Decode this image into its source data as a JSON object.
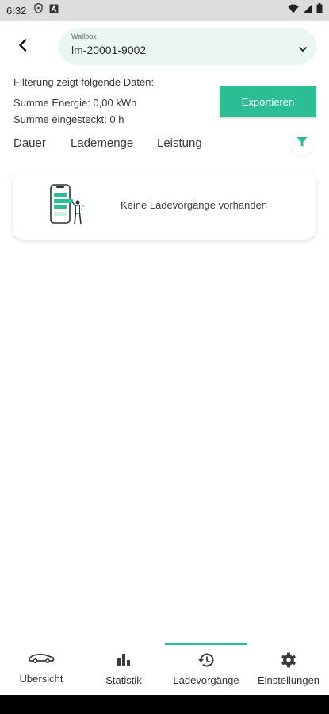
{
  "status_bar": {
    "time": "6:32",
    "left_icons": [
      "shield-icon",
      "a-badge-icon"
    ],
    "right_icons": [
      "wifi-icon",
      "signal-icon",
      "battery-icon"
    ]
  },
  "header": {
    "back_icon": "arrow-left-icon",
    "wallbox": {
      "label": "Wallbox",
      "value": "lm-20001-9002",
      "icon": "chevron-down-icon"
    }
  },
  "summary": {
    "filter_info": "Filterung zeigt folgende Daten:",
    "energy": "Summe Energie: 0,00 kWh",
    "plugged": "Summe eingesteckt: 0 h"
  },
  "export_button": "Exportieren",
  "sort_options": [
    "Dauer",
    "Lademenge",
    "Leistung"
  ],
  "filter_icon": "filter-icon",
  "empty_state": {
    "icon": "phone-person-illustration",
    "text": "Keine Ladevorgänge vorhanden"
  },
  "bottom_nav": {
    "active_index": 2,
    "items": [
      {
        "label": "Übersicht",
        "icon": "car-icon"
      },
      {
        "label": "Statistik",
        "icon": "bar-chart-icon"
      },
      {
        "label": "Ladevorgänge",
        "icon": "history-icon"
      },
      {
        "label": "Einstellungen",
        "icon": "gear-icon"
      }
    ]
  },
  "colors": {
    "accent": "#2bbd94",
    "select_background": "#e9f6f2",
    "status_bar": "#dcdcdc"
  }
}
